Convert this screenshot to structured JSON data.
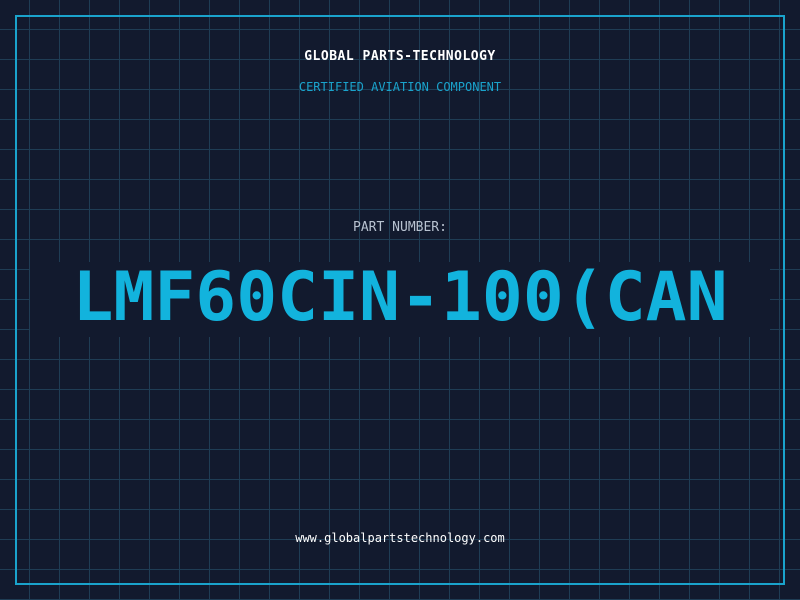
{
  "header": {
    "company": "GLOBAL PARTS-TECHNOLOGY",
    "tagline": "CERTIFIED AVIATION COMPONENT"
  },
  "part": {
    "label": "PART NUMBER:",
    "number": "LMF60CIN-100(CAN"
  },
  "footer": {
    "url": "www.globalpartstechnology.com"
  },
  "colors": {
    "background": "#121a2e",
    "grid": "#1f3d55",
    "accent": "#1aa3cc",
    "part_number": "#12b3dd",
    "text": "#ffffff"
  }
}
